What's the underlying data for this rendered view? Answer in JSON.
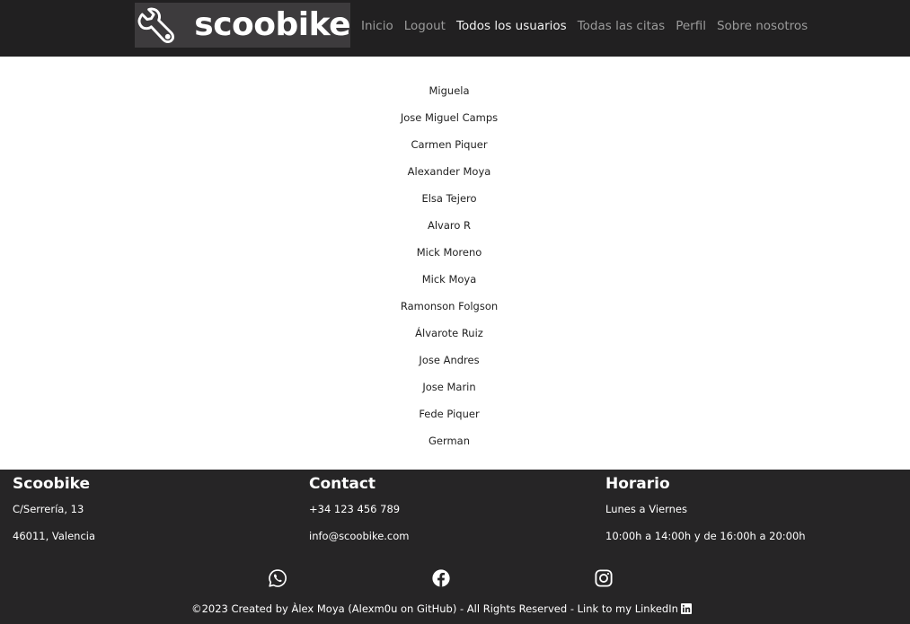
{
  "navbar": {
    "brand": "scoobike",
    "links": [
      {
        "label": "Inicio",
        "active": false
      },
      {
        "label": "Logout",
        "active": false
      },
      {
        "label": "Todos los usuarios",
        "active": true
      },
      {
        "label": "Todas las citas",
        "active": false
      },
      {
        "label": "Perfil",
        "active": false
      },
      {
        "label": "Sobre nosotros",
        "active": false
      }
    ]
  },
  "users": [
    "Miguela",
    "Jose Miguel Camps",
    "Carmen Piquer",
    "Alexander Moya",
    "Elsa Tejero",
    "Alvaro R",
    "Mick Moreno",
    "Mick Moya",
    "Ramonson Folgson",
    "Álvarote Ruiz",
    "Jose Andres",
    "Jose Marin",
    "Fede Piquer",
    "German"
  ],
  "footer": {
    "company": {
      "title": "Scoobike",
      "address": "C/Serrería, 13",
      "city": "46011, Valencia"
    },
    "contact": {
      "title": "Contact",
      "phone": "+34 123 456 789",
      "email": "info@scoobike.com"
    },
    "hours": {
      "title": "Horario",
      "days": "Lunes a Viernes",
      "time": "10:00h a 14:00h y de 16:00h a 20:00h"
    },
    "social_icons": [
      "whatsapp-icon",
      "facebook-icon",
      "instagram-icon"
    ],
    "copyright": "©2023 Created by Àlex Moya (Alexm0u on GitHub) - All Rights Reserved - Link to my LinkedIn"
  },
  "colors": {
    "navbar_bg": "#212021",
    "logo_bg": "#3d3b3d",
    "footer_bg": "#262526",
    "nav_link": "#9b9b9b",
    "nav_link_active": "#f2f2f2"
  }
}
